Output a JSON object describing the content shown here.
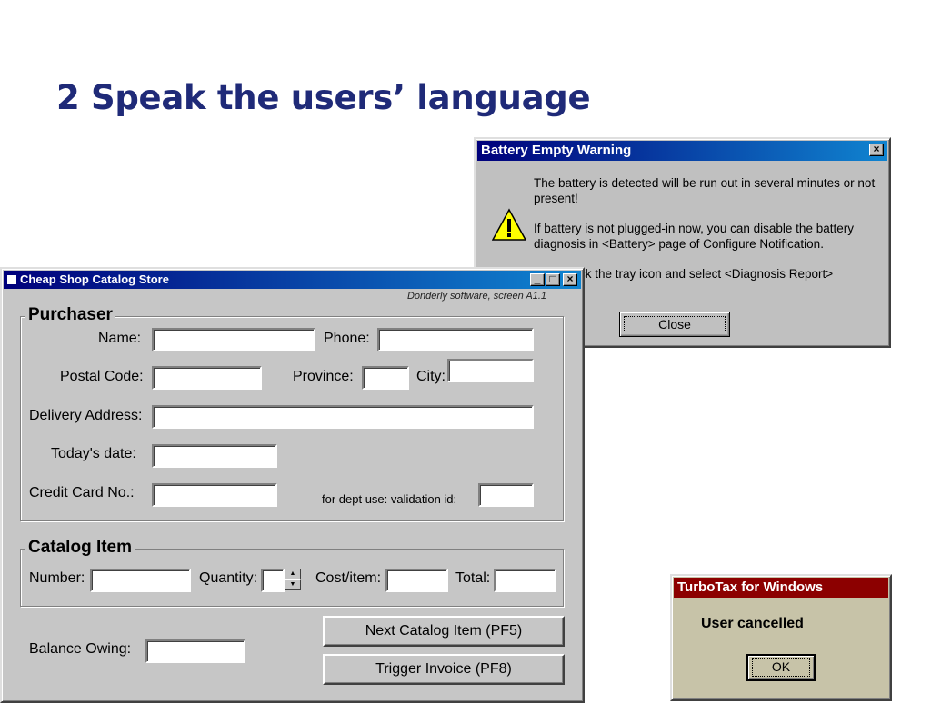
{
  "slide": {
    "title": "2 Speak the users’ language"
  },
  "battery_dialog": {
    "title": "Battery Empty Warning",
    "close_glyph": "×",
    "message_1": "The battery is detected will be run out in several minutes or not present!",
    "message_2": "If battery is not plugged-in now, you can disable the battery diagnosis in <Battery> page of Configure Notification.",
    "message_3": "ck the tray icon and select <Diagnosis Report>",
    "close_label": "Close",
    "icon": "warning-icon"
  },
  "shop_window": {
    "title": "Cheap Shop Catalog Store",
    "credit": "Donderly software, screen A1.1",
    "controls": {
      "minimize": "_",
      "maximize": "□",
      "close": "×"
    },
    "purchaser": {
      "group_label": "Purchaser",
      "name_label": "Name:",
      "phone_label": "Phone:",
      "postal_label": "Postal Code:",
      "province_label": "Province:",
      "city_label": "City:",
      "address_label": "Delivery Address:",
      "date_label": "Today's date:",
      "card_label": "Credit Card No.:",
      "validation_label": "for dept use: validation id:"
    },
    "catalog": {
      "group_label": "Catalog Item",
      "number_label": "Number:",
      "quantity_label": "Quantity:",
      "cost_label": "Cost/item:",
      "total_label": "Total:"
    },
    "balance_label": "Balance Owing:",
    "next_button": "Next Catalog Item (PF5)",
    "invoice_button": "Trigger Invoice (PF8)"
  },
  "turbotax_dialog": {
    "title": "TurboTax for Windows",
    "message": "User cancelled",
    "ok_label": "OK"
  }
}
